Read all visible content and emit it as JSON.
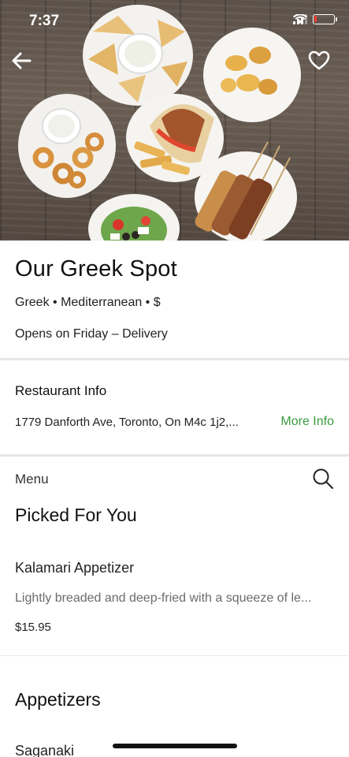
{
  "status_bar": {
    "time": "7:37"
  },
  "hero": {
    "back_icon": "arrow-left-icon",
    "favorite_icon": "heart-outline-icon"
  },
  "restaurant": {
    "name": "Our Greek Spot",
    "cuisine": "Greek • Mediterranean • $",
    "hours": "Opens on Friday – Delivery"
  },
  "info": {
    "heading": "Restaurant Info",
    "address": "1779 Danforth Ave, Toronto, On M4c 1j2,...",
    "more_info_label": "More Info"
  },
  "menu": {
    "label": "Menu",
    "search_icon": "search-icon",
    "sections": [
      {
        "title": "Picked For You",
        "items": [
          {
            "name": "Kalamari Appetizer",
            "description": "Lightly breaded and deep-fried with a squeeze of le...",
            "price": "$15.95"
          }
        ]
      },
      {
        "title": "Appetizers",
        "items": [
          {
            "name": "Saganaki"
          }
        ]
      }
    ]
  },
  "colors": {
    "accent_green": "#3a9a3f",
    "text_primary": "#111111",
    "text_secondary": "#6b6b6b",
    "divider": "#e6e6e6"
  }
}
